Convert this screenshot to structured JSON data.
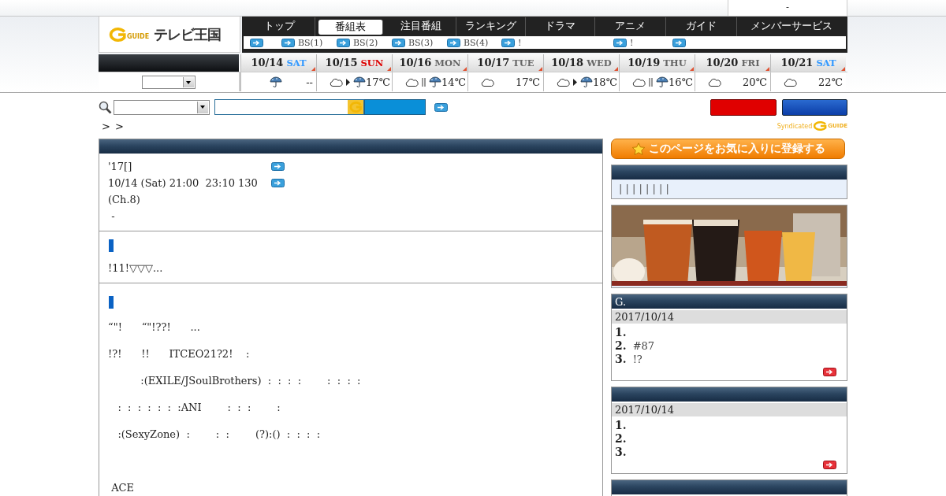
{
  "top_strip": {
    "text": "-"
  },
  "logo": {
    "mark": "GUIDE",
    "title": "テレビ王国"
  },
  "nav": {
    "tabs": [
      {
        "label": "トップ",
        "selected": false
      },
      {
        "label": "番組表",
        "selected": true
      },
      {
        "label": "注目番組",
        "selected": false
      },
      {
        "label": "ランキング",
        "selected": false
      },
      {
        "label": "ドラマ",
        "selected": false
      },
      {
        "label": "アニメ",
        "selected": false
      },
      {
        "label": "ガイド",
        "selected": false
      },
      {
        "label": "メンバーサービス",
        "selected": false
      }
    ]
  },
  "sub_nav": [
    {
      "kind": "plain"
    },
    {
      "kind": "labeled",
      "label": "BS(1)"
    },
    {
      "kind": "labeled",
      "label": "BS(2)"
    },
    {
      "kind": "labeled",
      "label": "BS(3)"
    },
    {
      "kind": "labeled",
      "label": "BS(4)"
    },
    {
      "kind": "labeled",
      "label": "!"
    },
    {
      "kind": "labeled",
      "label": "!"
    },
    {
      "kind": "plain"
    }
  ],
  "dates": [
    {
      "date": "10/14",
      "day": "SAT",
      "color": "#3399ff"
    },
    {
      "date": "10/15",
      "day": "SUN",
      "color": "#dd0000"
    },
    {
      "date": "10/16",
      "day": "MON",
      "color": "#666666"
    },
    {
      "date": "10/17",
      "day": "TUE",
      "color": "#666666"
    },
    {
      "date": "10/18",
      "day": "WED",
      "color": "#666666"
    },
    {
      "date": "10/19",
      "day": "THU",
      "color": "#666666"
    },
    {
      "date": "10/20",
      "day": "FRI",
      "color": "#666666"
    },
    {
      "date": "10/21",
      "day": "SAT",
      "color": "#3399ff"
    }
  ],
  "weather": [
    {
      "forecast": [
        {
          "kind": "rain"
        }
      ],
      "temp": "--"
    },
    {
      "forecast": [
        {
          "kind": "cloud"
        },
        {
          "kind": "then"
        },
        {
          "kind": "rain"
        }
      ],
      "temp": "17℃"
    },
    {
      "forecast": [
        {
          "kind": "cloud"
        },
        {
          "kind": "or"
        },
        {
          "kind": "rain"
        }
      ],
      "temp": "14℃"
    },
    {
      "forecast": [
        {
          "kind": "cloud"
        }
      ],
      "temp": "17℃"
    },
    {
      "forecast": [
        {
          "kind": "cloud"
        },
        {
          "kind": "then"
        },
        {
          "kind": "rain"
        }
      ],
      "temp": "18℃"
    },
    {
      "forecast": [
        {
          "kind": "cloud"
        },
        {
          "kind": "or"
        },
        {
          "kind": "rain"
        }
      ],
      "temp": "16℃"
    },
    {
      "forecast": [
        {
          "kind": "cloud"
        }
      ],
      "temp": "20℃"
    },
    {
      "forecast": [
        {
          "kind": "cloud"
        }
      ],
      "temp": "22℃"
    }
  ],
  "breadcrumb": [
    ">",
    ">"
  ],
  "syndicated": {
    "prefix": "Syndicated",
    "mark": "GUIDE"
  },
  "favorite_button": {
    "label": "このページをお気に入りに登録する"
  },
  "main": {
    "sections": [
      {
        "marker": false,
        "kind": "compact",
        "lines": [
          {
            "text": "'17[]",
            "link": true
          },
          {
            "text": "10/14 (Sat) 21:00  23:10 130",
            "link": true
          },
          {
            "text": "(Ch.8)",
            "link": false
          },
          {
            "text": " -",
            "link": false
          }
        ]
      },
      {
        "marker": true,
        "kind": "compact",
        "lines": [
          {
            "text": "!11!▽▽▽...",
            "link": false
          }
        ]
      },
      {
        "marker": true,
        "kind": "spaced",
        "lines": [
          {
            "text": "“\"!      “\"!??!      ...",
            "link": false
          },
          {
            "text": "!?!      !!      ITCEO21?2!    :",
            "link": false
          },
          {
            "text": "          :(EXILE/JSoulBrothers)  :  :  :  :        :  :  :  :",
            "link": false
          },
          {
            "text": "   :  :  :  :  :  :  :ANI        :  :  :        :",
            "link": false
          },
          {
            "text": "   :(SexyZone)  :        :  :        (?):()  :  :  :  :",
            "link": false
          },
          {
            "text": " ACE",
            "link": false,
            "gap": true
          }
        ]
      }
    ]
  },
  "sidebar": {
    "panels": [
      {
        "kind": "links",
        "body": "| | | | | | | |"
      },
      {
        "kind": "picture"
      },
      {
        "kind": "ranking",
        "title": "G.",
        "date": "2017/10/14",
        "items": [
          {
            "number": "1."
          },
          {
            "number": "2.",
            "text": "#87"
          },
          {
            "number": "3.",
            "text": "!?"
          }
        ]
      },
      {
        "kind": "ranking",
        "date": "2017/10/14",
        "items": [
          {
            "number": "1."
          },
          {
            "number": "2."
          },
          {
            "number": "3."
          }
        ]
      },
      {
        "kind": "ranking"
      }
    ]
  }
}
